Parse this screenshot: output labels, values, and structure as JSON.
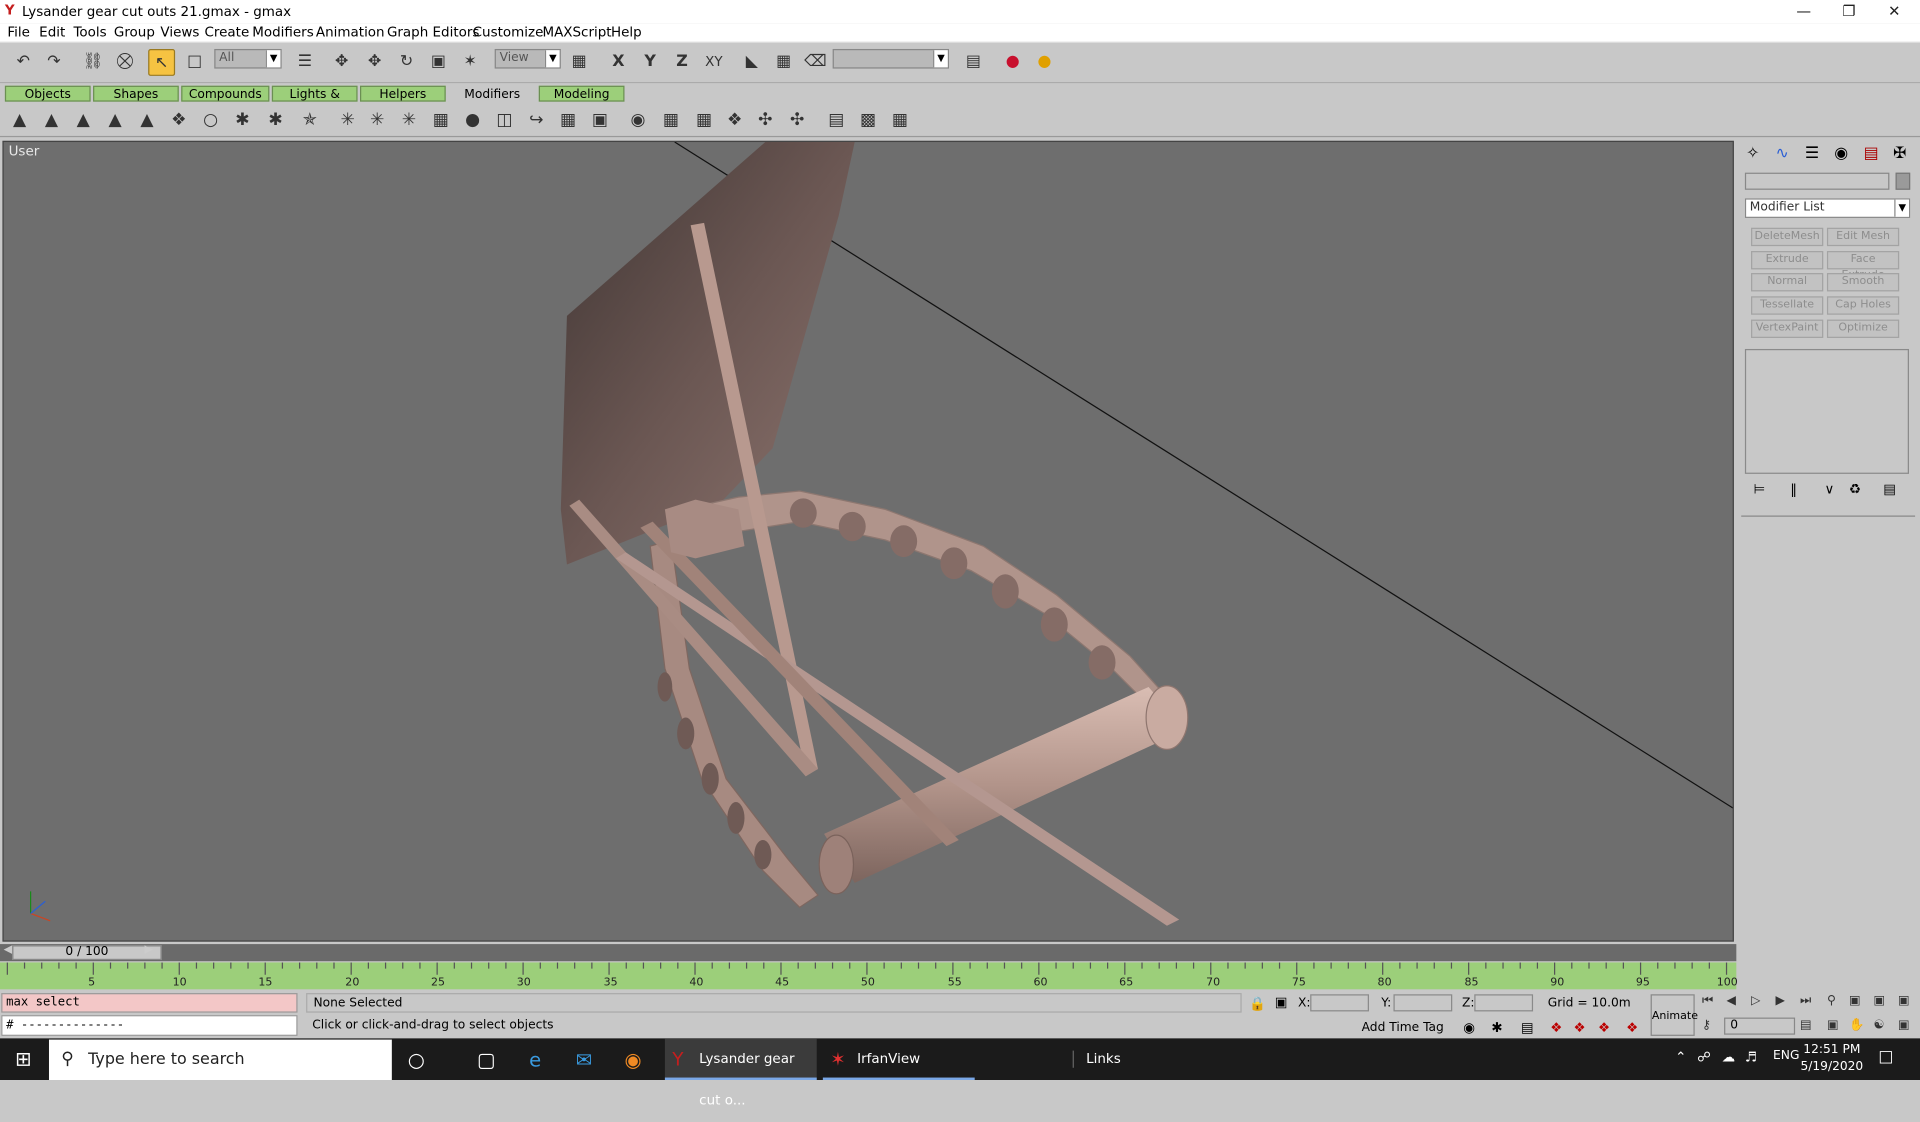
{
  "window": {
    "title": "Lysander gear cut outs 21.gmax - gmax",
    "app_icon": "gmax-icon",
    "controls": [
      "minimize",
      "restore",
      "close"
    ]
  },
  "menu": [
    "File",
    "Edit",
    "Tools",
    "Group",
    "Views",
    "Create",
    "Modifiers",
    "Animation",
    "Graph Editors",
    "Customize",
    "MAXScript",
    "Help"
  ],
  "toolbar": {
    "selection_filter": "All",
    "reference_coord": "View",
    "axis_buttons": [
      "X",
      "Y",
      "Z",
      "XY"
    ],
    "named_selection": ""
  },
  "tabs": [
    {
      "label": "Objects",
      "active": false
    },
    {
      "label": "Shapes",
      "active": false
    },
    {
      "label": "Compounds",
      "active": false
    },
    {
      "label": "Lights & Cameras",
      "active": false
    },
    {
      "label": "Helpers",
      "active": false
    },
    {
      "label": "Modifiers",
      "active": true
    },
    {
      "label": "Modeling",
      "active": false
    }
  ],
  "viewport": {
    "label": "User",
    "bg_color": "#6e6e6e",
    "object_color": "#b89a90"
  },
  "command_panel": {
    "name_field": "",
    "modifier_list": "Modifier List",
    "buttons": [
      "DeleteMesh",
      "Edit Mesh",
      "Extrude",
      "Face Extrude",
      "Normal",
      "Smooth",
      "Tessellate",
      "Cap Holes",
      "VertexPaint",
      "Optimize"
    ]
  },
  "timeline": {
    "frame_display": "0 / 100",
    "ticks": [
      "5",
      "10",
      "15",
      "20",
      "25",
      "30",
      "35",
      "40",
      "45",
      "50",
      "55",
      "60",
      "65",
      "70",
      "75",
      "80",
      "85",
      "90",
      "95",
      "100"
    ]
  },
  "status": {
    "maxscript_input": "max select",
    "maxscript_output": "# --------------",
    "selection": "None Selected",
    "prompt": "Click or click-and-drag to select objects",
    "x_label": "X:",
    "y_label": "Y:",
    "z_label": "Z:",
    "grid": "Grid = 10.0m",
    "add_time_tag": "Add Time Tag",
    "animate": "Animate",
    "frame_field": "0"
  },
  "taskbar": {
    "search_placeholder": "Type here to search",
    "apps": [
      {
        "label": "Lysander gear cut o...",
        "icon": "gmax-icon"
      },
      {
        "label": "IrfanView",
        "icon": "irfanview-icon"
      }
    ],
    "links": "Links",
    "language": "ENG",
    "time": "12:51 PM",
    "date": "5/19/2020"
  }
}
